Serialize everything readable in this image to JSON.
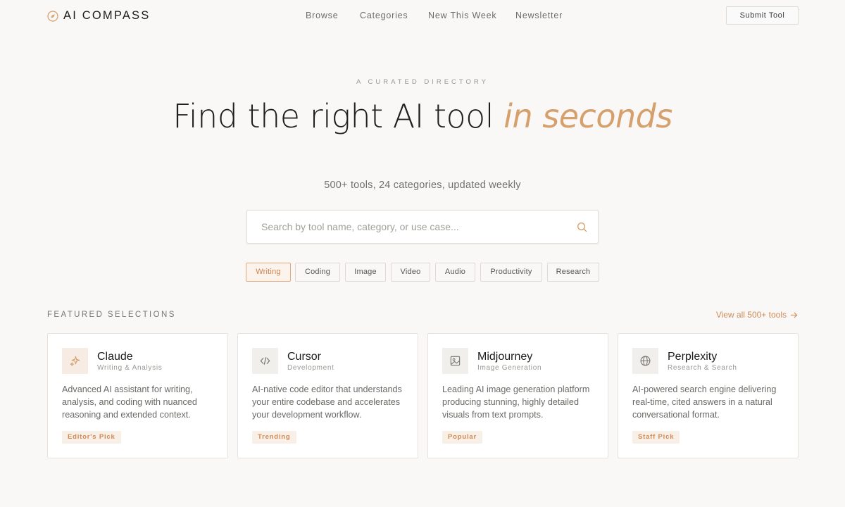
{
  "brand": {
    "name": "AI COMPASS",
    "icon": "compass-icon"
  },
  "nav": [
    {
      "label": "Browse"
    },
    {
      "label": "Categories"
    },
    {
      "label": "New This Week"
    },
    {
      "label": "Newsletter"
    }
  ],
  "header": {
    "submit_label": "Submit Tool"
  },
  "hero": {
    "eyebrow": "A CURATED DIRECTORY",
    "title_main": "Find the right AI tool ",
    "title_accent": "in seconds",
    "subtitle": "500+ tools, 24 categories, updated weekly"
  },
  "search": {
    "placeholder": "Search by tool name, category, or use case...",
    "value": "",
    "icon": "search-icon"
  },
  "chips": [
    {
      "label": "Writing",
      "active": true
    },
    {
      "label": "Coding",
      "active": false
    },
    {
      "label": "Image",
      "active": false
    },
    {
      "label": "Video",
      "active": false
    },
    {
      "label": "Audio",
      "active": false
    },
    {
      "label": "Productivity",
      "active": false
    },
    {
      "label": "Research",
      "active": false
    }
  ],
  "featured": {
    "label": "FEATURED SELECTIONS",
    "view_all": "View all 500+ tools",
    "cards": [
      {
        "name": "Claude",
        "category": "Writing & Analysis",
        "description": "Advanced AI assistant for writing, analysis, and coding with nuanced reasoning and extended context.",
        "badge": "Editor's Pick",
        "icon": "sparkle-icon"
      },
      {
        "name": "Cursor",
        "category": "Development",
        "description": "AI-native code editor that understands your entire codebase and accelerates your development workflow.",
        "badge": "Trending",
        "icon": "code-icon"
      },
      {
        "name": "Midjourney",
        "category": "Image Generation",
        "description": "Leading AI image generation platform producing stunning, highly detailed visuals from text prompts.",
        "badge": "Popular",
        "icon": "image-icon"
      },
      {
        "name": "Perplexity",
        "category": "Research & Search",
        "description": "AI-powered search engine delivering real-time, cited answers in a natural conversational format.",
        "badge": "Staff Pick",
        "icon": "globe-icon"
      }
    ]
  },
  "colors": {
    "accent": "#d6a06c",
    "accent_text": "#cf8a56",
    "background": "#f9f8f6"
  }
}
